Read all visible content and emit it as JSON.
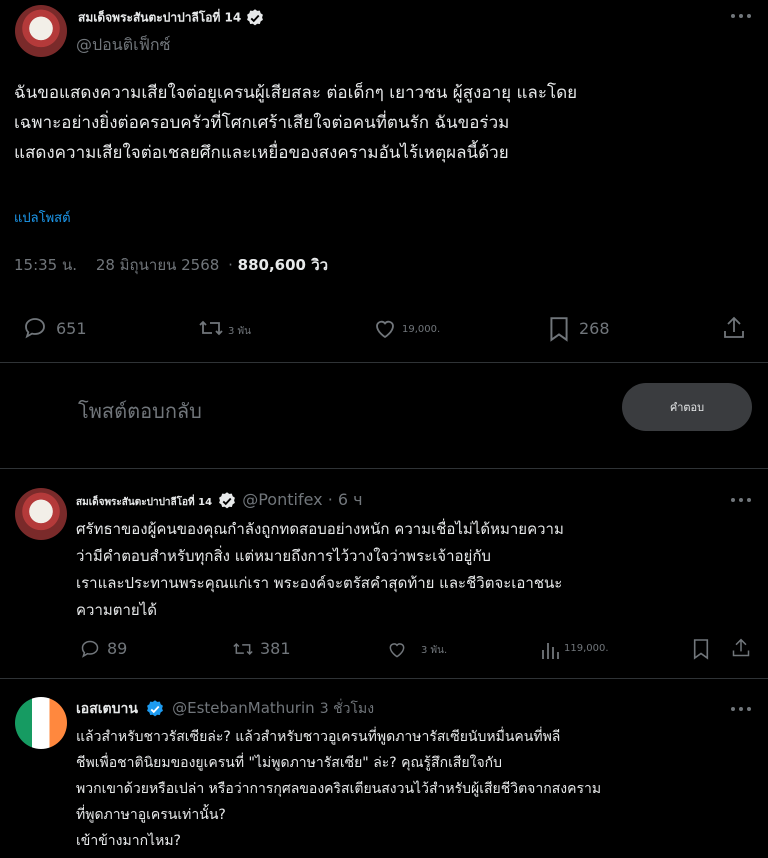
{
  "main_post": {
    "author_name": "สมเด็จพระสันตะปาปาลีโอที่ 14",
    "handle": "@ปอนติเฟ็กซ์",
    "text_lines": [
      "ฉันขอแสดงความเสียใจต่อยูเครนผู้เสียสละ ต่อเด็กๆ เยาวชน ผู้สูงอายุ และโดย",
      "เฉพาะอย่างยิ่งต่อครอบครัวที่โศกเศร้าเสียใจต่อคนที่ตนรัก ฉันขอร่วม",
      "แสดงความเสียใจต่อเชลยศึกและเหยื่อของสงครามอันไร้เหตุผลนี้ด้วย"
    ],
    "translate_label": "แปลโพสต์",
    "time": "15:35 น.",
    "date": "28 มิถุนายน 2568",
    "views": "880,600 วิว",
    "replies": "651",
    "reposts": "3 พัน",
    "likes": "19,000.",
    "bookmarks": "268",
    "reply_placeholder": "โพสต์ตอบกลับ",
    "reply_button": "คำตอบ"
  },
  "reply1": {
    "author_name": "สมเด็จพระสันตะปาปาลีโอที่ 14",
    "handle": "@Pontifex",
    "time": "· 6 ч",
    "text_lines": [
      "ศรัทธาของผู้คนของคุณกำลังถูกทดสอบอย่างหนัก ความเชื่อไม่ได้หมายความ",
      "ว่ามีคำตอบสำหรับทุกสิ่ง แต่หมายถึงการไว้วางใจว่าพระเจ้าอยู่กับ",
      "เราและประทานพระคุณแก่เรา พระองค์จะตรัสคำสุดท้าย และชีวิตจะเอาชนะ",
      "ความตายได้"
    ],
    "replies": "89",
    "reposts": "381",
    "likes": "3 พัน.",
    "views": "119,000."
  },
  "reply2": {
    "author_name": "เอสเตบาน",
    "handle": "@EstebanMathurin",
    "time": "3 ชั่วโมง",
    "text_lines": [
      "แล้วสำหรับชาวรัสเซียล่ะ? แล้วสำหรับชาวอูเครนที่พูดภาษารัสเซียนับหมื่นคนที่พลี",
      "ชีพเพื่อชาตินิยมของยูเครนที่ \"ไม่พูดภาษารัสเซีย\" ล่ะ? คุณรู้สึกเสียใจกับ",
      "พวกเขาด้วยหรือเปล่า หรือว่าการกุศลของคริสเตียนสงวนไว้สำหรับผู้เสียชีวิตจากสงคราม",
      "ที่พูดภาษาอูเครนเท่านั้น?",
      "เข้าข้างมากไหม?"
    ]
  },
  "colors": {
    "background": "#000000",
    "text": "#e7e9ea",
    "muted": "#71767b",
    "link": "#1d9bf0",
    "verified": "#1d9bf0",
    "button_bg": "#3a3c3f"
  }
}
